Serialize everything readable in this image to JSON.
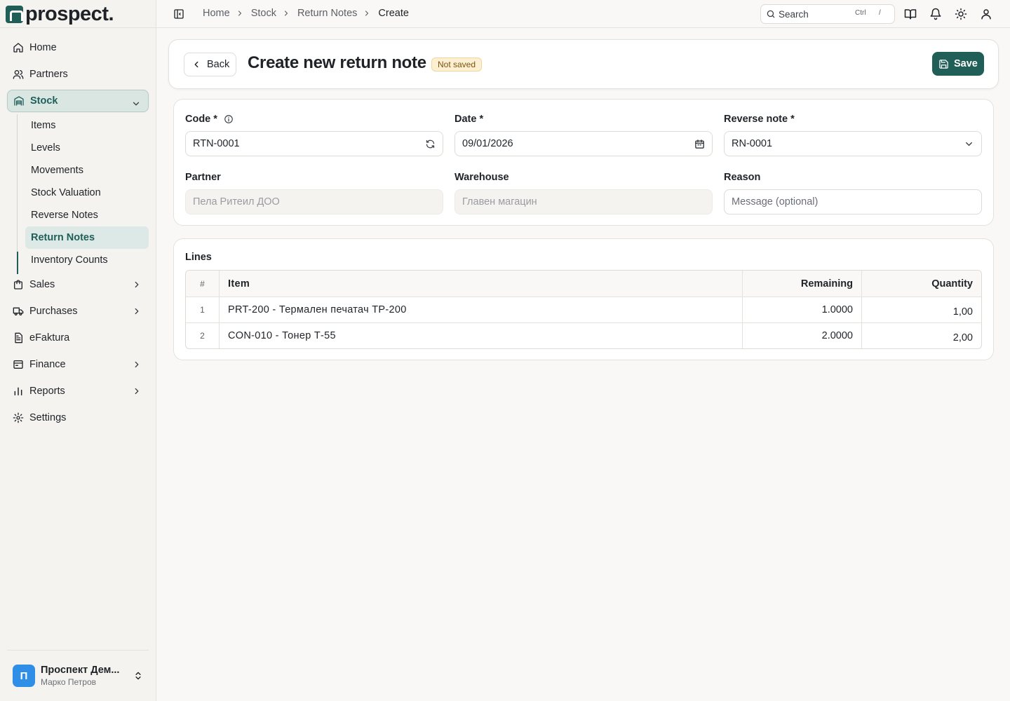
{
  "app": {
    "name": "prospect."
  },
  "sidebar": {
    "items": [
      {
        "label": "Home",
        "icon": "home-icon"
      },
      {
        "label": "Partners",
        "icon": "users-icon"
      },
      {
        "label": "Stock",
        "icon": "warehouse-icon",
        "expanded": true
      },
      {
        "label": "Sales",
        "icon": "bag-icon"
      },
      {
        "label": "Purchases",
        "icon": "truck-icon"
      },
      {
        "label": "eFaktura",
        "icon": "document-icon"
      },
      {
        "label": "Finance",
        "icon": "wallet-icon"
      },
      {
        "label": "Reports",
        "icon": "bar-chart-icon"
      },
      {
        "label": "Settings",
        "icon": "gear-icon"
      }
    ],
    "stock_sub": [
      "Items",
      "Levels",
      "Movements",
      "Stock Valuation",
      "Reverse Notes",
      "Return Notes",
      "Inventory Counts"
    ],
    "active_sub": "Return Notes",
    "workspace": {
      "initial": "П",
      "name": "Проспект Дем...",
      "user": "Марко Петров"
    }
  },
  "topbar": {
    "breadcrumb": [
      "Home",
      "Stock",
      "Return Notes",
      "Create"
    ],
    "search": {
      "placeholder": "Search",
      "kbd1": "Ctrl",
      "kbd2": "/"
    }
  },
  "header": {
    "back_label": "Back",
    "title": "Create new return note",
    "status_badge": "Not saved",
    "save_label": "Save"
  },
  "form": {
    "code": {
      "label": "Code *",
      "value": "RTN-0001"
    },
    "date": {
      "label": "Date *",
      "value": "09/01/2026"
    },
    "reverse_note": {
      "label": "Reverse note *",
      "value": "RN-0001"
    },
    "partner": {
      "label": "Partner",
      "value": "Пела Ритеил ДОО"
    },
    "warehouse": {
      "label": "Warehouse",
      "value": "Главен магацин"
    },
    "reason": {
      "label": "Reason",
      "placeholder": "Message (optional)"
    }
  },
  "lines": {
    "title": "Lines",
    "columns": {
      "num": "#",
      "item": "Item",
      "remaining": "Remaining",
      "quantity": "Quantity"
    },
    "rows": [
      {
        "num": "1",
        "item": "PRT-200 - Термален печатач TP-200",
        "remaining": "1.0000",
        "quantity": "1,00"
      },
      {
        "num": "2",
        "item": "CON-010 - Тонер Т-55",
        "remaining": "2.0000",
        "quantity": "2,00"
      }
    ]
  },
  "colors": {
    "accent": "#1f5f58",
    "badge_bg": "#fdf0d2",
    "avatar": "#2f8fe6"
  }
}
